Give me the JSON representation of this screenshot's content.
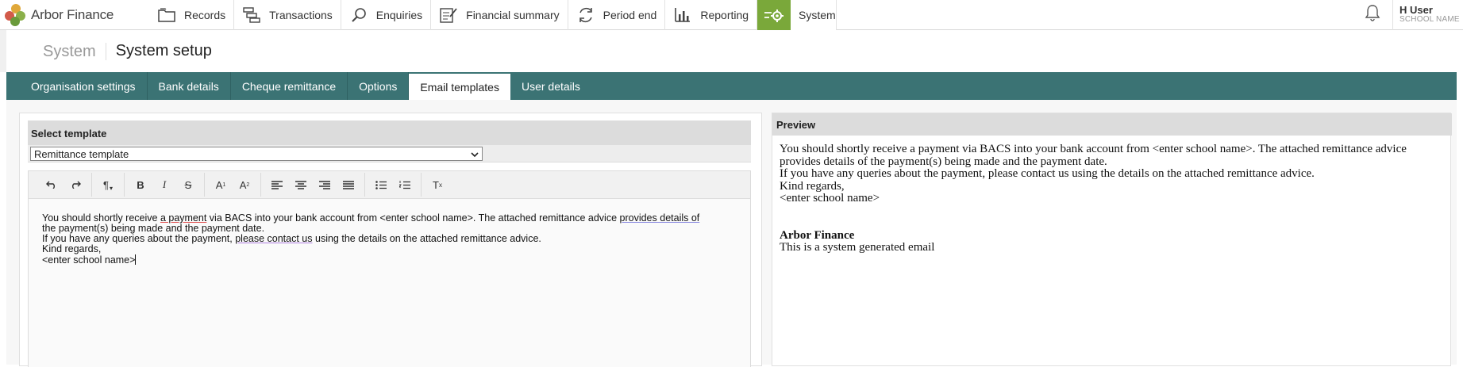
{
  "brand": {
    "name": "Arbor Finance"
  },
  "nav": {
    "items": [
      {
        "label": "Records",
        "icon": "folder-icon"
      },
      {
        "label": "Transactions",
        "icon": "transactions-icon"
      },
      {
        "label": "Enquiries",
        "icon": "search-icon"
      },
      {
        "label": "Financial summary",
        "icon": "checklist-icon"
      },
      {
        "label": "Period end",
        "icon": "refresh-icon"
      },
      {
        "label": "Reporting",
        "icon": "bar-chart-icon"
      },
      {
        "label": "System",
        "icon": "system-gear-icon"
      }
    ],
    "active": "System",
    "accent": "#7aa83a"
  },
  "user": {
    "name": "H User",
    "school": "SCHOOL NAME"
  },
  "page": {
    "section": "System",
    "title": "System setup"
  },
  "tabs": [
    {
      "label": "Organisation settings"
    },
    {
      "label": "Bank details"
    },
    {
      "label": "Cheque remittance"
    },
    {
      "label": "Options"
    },
    {
      "label": "Email templates"
    },
    {
      "label": "User details"
    }
  ],
  "active_tab": "Email templates",
  "tab_bar_color": "#3b7374",
  "template_select": {
    "heading": "Select template",
    "selected": "Remittance template"
  },
  "toolbar": {
    "buttons": [
      "undo-icon",
      "redo-icon",
      "paragraph-format-icon",
      "bold-icon",
      "italic-icon",
      "strikethrough-icon",
      "superscript-icon",
      "subscript-icon",
      "align-left-icon",
      "align-center-icon",
      "align-right-icon",
      "align-justify-icon",
      "bullet-list-icon",
      "numbered-list-icon",
      "clear-formatting-icon"
    ]
  },
  "editor": {
    "line1_a": "You should shortly receive ",
    "line1_b": "a payment",
    "line1_c": " via BACS into your bank account from <enter school name>. The attached remittance advice ",
    "line1_d": "provides details of",
    "line2": "the payment(s) being made and the payment date.",
    "line3_a": "If you have any queries about the payment, ",
    "line3_b": "please contact us",
    "line3_c": " using the details on the attached remittance advice.",
    "line4": "Kind regards,",
    "line5": "<enter school name>"
  },
  "preview": {
    "heading": "Preview",
    "para1": "You should shortly receive a payment via BACS into your bank account from <enter school name>. The attached remittance advice provides details of the payment(s) being made and the payment date.",
    "para2": "If you have any queries about the payment, please contact us using the details on the attached remittance advice.",
    "para3": "Kind regards,",
    "para4": "<enter school name>",
    "signature": "Arbor Finance",
    "footer": "This is a system generated email"
  }
}
